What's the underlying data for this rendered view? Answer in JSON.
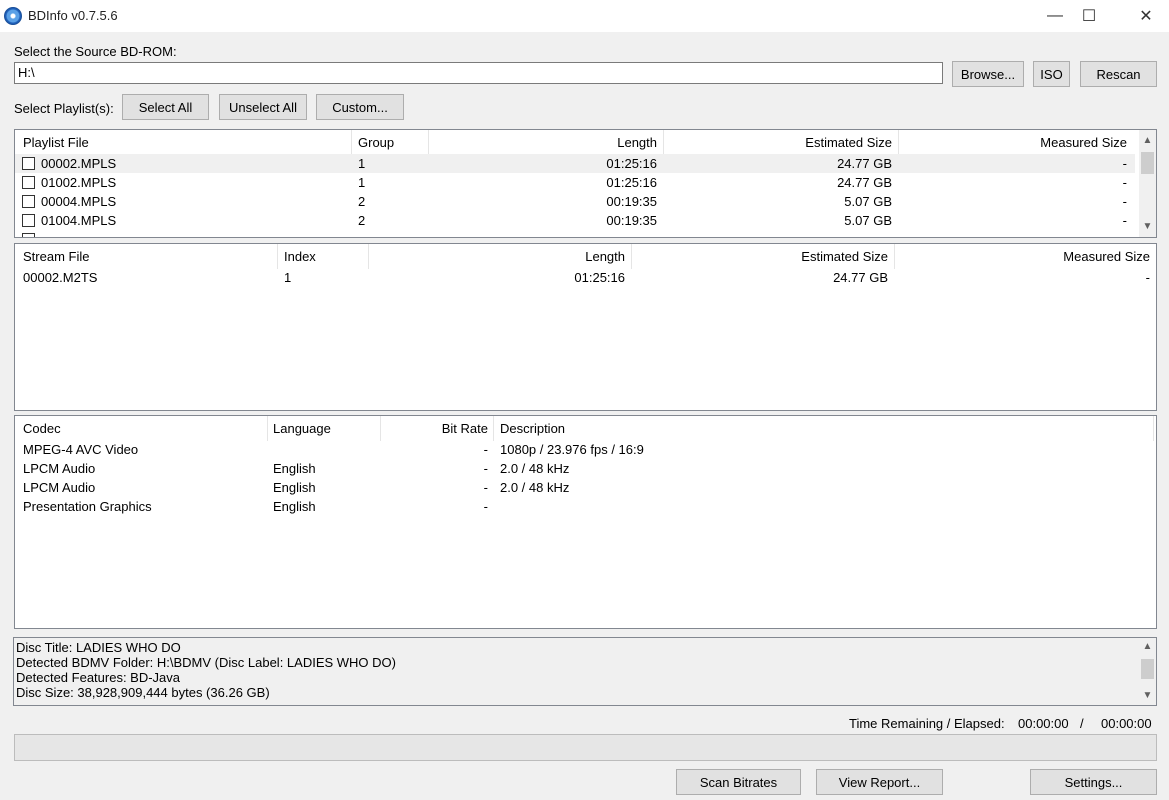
{
  "window": {
    "title": "BDInfo v0.7.5.6",
    "minimize_glyph": "—",
    "maximize_glyph": "☐",
    "close_glyph": "✕"
  },
  "source": {
    "label": "Select the Source BD-ROM:",
    "path": "H:\\",
    "browse_label": "Browse...",
    "iso_label": "ISO",
    "rescan_label": "Rescan"
  },
  "playlist_controls": {
    "label": "Select Playlist(s):",
    "select_all": "Select All",
    "unselect_all": "Unselect All",
    "custom": "Custom..."
  },
  "playlists": {
    "columns": [
      "Playlist File",
      "Group",
      "Length",
      "Estimated Size",
      "Measured Size"
    ],
    "rows": [
      {
        "file": "00002.MPLS",
        "group": "1",
        "length": "01:25:16",
        "estimated": "24.77 GB",
        "measured": "-"
      },
      {
        "file": "01002.MPLS",
        "group": "1",
        "length": "01:25:16",
        "estimated": "24.77 GB",
        "measured": "-"
      },
      {
        "file": "00004.MPLS",
        "group": "2",
        "length": "00:19:35",
        "estimated": "5.07 GB",
        "measured": "-"
      },
      {
        "file": "01004.MPLS",
        "group": "2",
        "length": "00:19:35",
        "estimated": "5.07 GB",
        "measured": "-"
      }
    ]
  },
  "streams": {
    "columns": [
      "Stream File",
      "Index",
      "Length",
      "Estimated Size",
      "Measured Size"
    ],
    "rows": [
      {
        "file": "00002.M2TS",
        "index": "1",
        "length": "01:25:16",
        "estimated": "24.77 GB",
        "measured": "-"
      }
    ]
  },
  "codecs": {
    "columns": [
      "Codec",
      "Language",
      "Bit Rate",
      "Description"
    ],
    "rows": [
      {
        "codec": "MPEG-4 AVC Video",
        "language": "",
        "bitrate": "-",
        "description": "1080p / 23.976 fps / 16:9"
      },
      {
        "codec": "LPCM Audio",
        "language": "English",
        "bitrate": "-",
        "description": "2.0 / 48 kHz"
      },
      {
        "codec": "LPCM Audio",
        "language": "English",
        "bitrate": "-",
        "description": "2.0 / 48 kHz"
      },
      {
        "codec": "Presentation Graphics",
        "language": "English",
        "bitrate": "-",
        "description": ""
      }
    ]
  },
  "log": [
    "Disc Title: LADIES WHO DO",
    "Detected BDMV Folder: H:\\BDMV (Disc Label: LADIES WHO DO)",
    "Detected Features: BD-Java",
    "Disc Size: 38,928,909,444 bytes (36.26 GB)"
  ],
  "status": {
    "label": "Time Remaining / Elapsed:",
    "remaining": "00:00:00",
    "separator": "/",
    "elapsed": "00:00:00",
    "progress": 0
  },
  "actions": {
    "scan": "Scan Bitrates",
    "report": "View Report...",
    "settings": "Settings..."
  },
  "icons": {
    "scroll_up": "▲",
    "scroll_down": "▼"
  }
}
